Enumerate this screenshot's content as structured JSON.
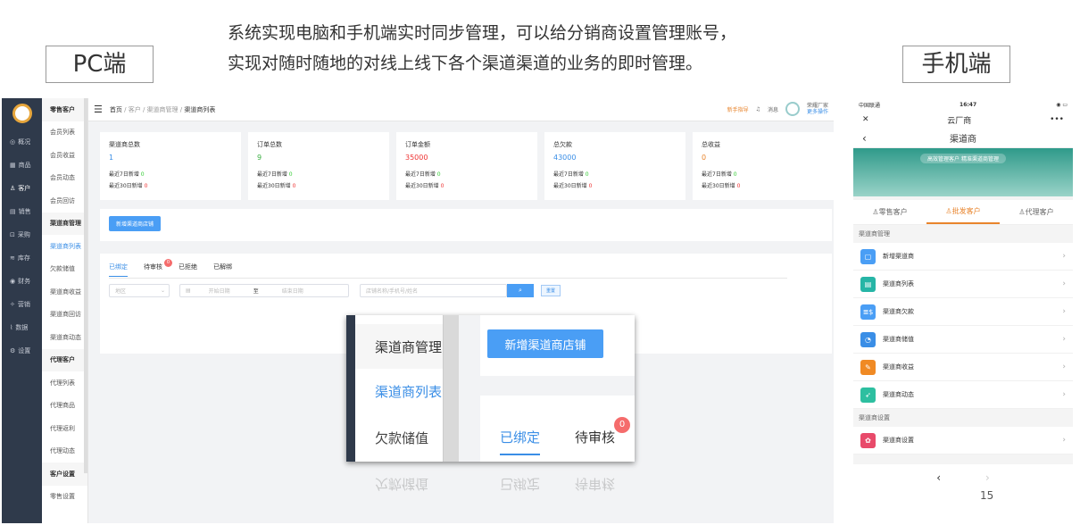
{
  "pc_label": "PC端",
  "mobile_label": "手机端",
  "headline_line1": "系统实现电脑和手机端实时同步管理，可以给分销商设置管理账号，",
  "headline_line2": "实现对随时随地的对线上线下各个渠道渠道的业务的即时管理。",
  "page_number": "15",
  "icon_nav": [
    {
      "label": "概况",
      "icon": "dashboard-icon"
    },
    {
      "label": "商品",
      "icon": "grid-icon"
    },
    {
      "label": "客户",
      "icon": "user-icon"
    },
    {
      "label": "销售",
      "icon": "doc-icon"
    },
    {
      "label": "采购",
      "icon": "cart-icon"
    },
    {
      "label": "库存",
      "icon": "layers-icon"
    },
    {
      "label": "财务",
      "icon": "money-icon"
    },
    {
      "label": "营销",
      "icon": "gift-icon"
    },
    {
      "label": "数据",
      "icon": "chart-icon"
    },
    {
      "label": "设置",
      "icon": "gear-icon"
    }
  ],
  "sub_nav": [
    "零售客户",
    "会员列表",
    "会员收益",
    "会员动态",
    "会员回访",
    "渠道商管理",
    "渠道商列表",
    "欠款储值",
    "渠道商收益",
    "渠道商回访",
    "渠道商动态",
    "代理客户",
    "代理列表",
    "代理商品",
    "代理返利",
    "代理动态",
    "客户设置",
    "零售设置"
  ],
  "breadcrumb": {
    "home": "首页",
    "sep": "/",
    "c1": "客户",
    "c2": "渠道商管理",
    "c3": "渠道商列表"
  },
  "topbar": {
    "guide": "新手指导",
    "msg": "消息",
    "user": "荣耀厂家",
    "more": "更多操作"
  },
  "stats": [
    {
      "title": "渠道商总数",
      "value": "1",
      "recent7_label": "最近7日新增",
      "recent7": "0",
      "recent30_label": "最近30日新增",
      "recent30": "0",
      "color": "#3a8ee6"
    },
    {
      "title": "订单总数",
      "value": "9",
      "recent7_label": "最近7日新增",
      "recent7": "0",
      "recent30_label": "最近30日新增",
      "recent30": "0",
      "color": "#3cb043"
    },
    {
      "title": "订单金额",
      "value": "35000",
      "recent7_label": "最近7日新增",
      "recent7": "0",
      "recent30_label": "最近30日新增",
      "recent30": "0",
      "color": "#e33"
    },
    {
      "title": "总欠款",
      "value": "43000",
      "recent7_label": "最近7日新增",
      "recent7": "0",
      "recent30_label": "最近30日新增",
      "recent30": "0",
      "color": "#3a8ee6"
    },
    {
      "title": "总收益",
      "value": "0",
      "recent7_label": "最近7日新增",
      "recent7": "0",
      "recent30_label": "最近30日新增",
      "recent30": "0",
      "color": "#e8842c"
    }
  ],
  "add_button": "新增渠道商店铺",
  "tabs": [
    "已绑定",
    "待审核",
    "已拒绝",
    "已解绑"
  ],
  "pending_badge": "0",
  "filter": {
    "region": "地区",
    "start": "开始日期",
    "to": "至",
    "end": "结束日期",
    "search_ph": "店铺名称/手机号/姓名",
    "reset": "重置"
  },
  "zoom": {
    "nav1": "渠道商管理",
    "nav2": "渠道商列表",
    "nav3": "欠款储值",
    "button": "新增渠道商店铺",
    "tab1": "已绑定",
    "tab2": "待审核",
    "badge": "0"
  },
  "phone": {
    "carrier": "中国联通",
    "time": "16:47",
    "app_title": "云厂商",
    "page_title": "渠道商",
    "banner": "高效管理客户 精准渠道商管理",
    "tabs": [
      "零售客户",
      "批发客户",
      "代理客户"
    ],
    "sec1": "渠道商管理",
    "rows": [
      {
        "label": "新增渠道商",
        "color": "#4a9ef5"
      },
      {
        "label": "渠道商列表",
        "color": "#26b5a6"
      },
      {
        "label": "渠道商欠款",
        "color": "#4a9ef5"
      },
      {
        "label": "渠道商储值",
        "color": "#3a8ee6"
      },
      {
        "label": "渠道商收益",
        "color": "#f08a24"
      },
      {
        "label": "渠道商动态",
        "color": "#2dbfa0"
      }
    ],
    "sec2": "渠道商设置",
    "row_settings": "渠道商设置"
  }
}
